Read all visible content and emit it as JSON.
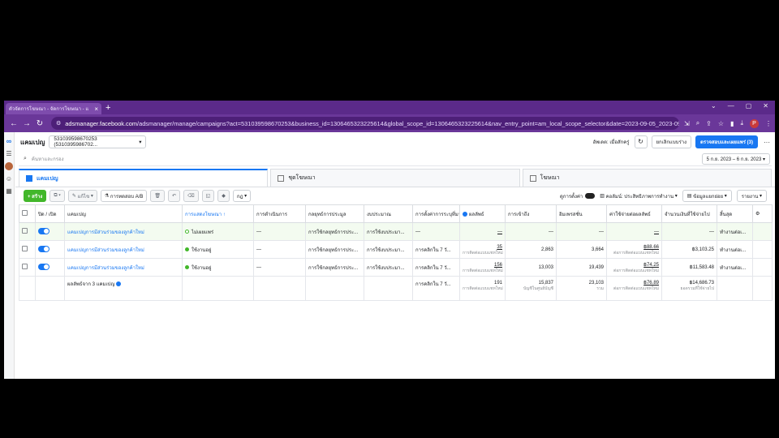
{
  "browser": {
    "tab_title": "ตัวจัดการโฆษณา - จัดการโฆษณา - แ",
    "new_tab": "+",
    "url_domain": "adsmanager.facebook.com",
    "url_path": "/adsmanager/manage/campaigns?act=531039598670253&business_id=1306465323225614&global_scope_id=1306465323225614&nav_entry_point=am_local_scope_selector&date=2023-09-05_2023-09-07&comparison...",
    "profile_letter": "P"
  },
  "header": {
    "title": "แคมเปญ",
    "account": "531039598670253 (5310395986702...",
    "updated": "อัพเดต: เมื่อสักครู่",
    "discard": "ยกเลิกแบบร่าง",
    "review_publish": "ตรวจสอบและเผยแพร่ (3)"
  },
  "search": {
    "placeholder": "ค้นหาและกรอง",
    "date_range": "5 ก.ย. 2023 – 6 ก.ย. 2023"
  },
  "level_tabs": [
    {
      "label": "แคมเปญ"
    },
    {
      "label": "ชุดโฆษณา"
    },
    {
      "label": "โฆษณา"
    }
  ],
  "toolbar": {
    "create": "+ สร้าง",
    "edit": "แก้ไข",
    "ab_test": "การทดสอบ A/B",
    "rules": "กฎ",
    "breakdown_toggle": "ดูการตั้งค่า",
    "columns": "คอลัมน์: ประสิทธิภาพการทำงาน",
    "breakdown": "ข้อมูลแยกย่อย",
    "reports": "รายงาน"
  },
  "table": {
    "headers": [
      "ปิด / เปิด",
      "แคมเปญ",
      "การแสดงโฆษณา ↑",
      "การดำเนินการ",
      "กลยุทธ์การประมูล",
      "งบประมาณ",
      "การตั้งค่าการระบุที่มา",
      "ผลลัพธ์",
      "การเข้าถึง",
      "อิมเพรสชั่น",
      "ค่าใช้จ่ายต่อผลลัพธ์",
      "จำนวนเงินที่ใช้จ่ายไป",
      "สิ้นสุด"
    ],
    "rows": [
      {
        "name": "แคมเปญการมีส่วนร่วมของลูกค้าใหม่",
        "status": "ไม่เผยแพร่",
        "action": "—",
        "bid": "การใช้กลยุทธ์การประ...",
        "budget": "การใช้งบประมา...",
        "attribution": "—",
        "results": "—",
        "results_sub": "",
        "reach": "—",
        "impressions": "—",
        "cpr": "—",
        "cpr_sub": "",
        "spent": "—",
        "end": "ทำงานต่อเ..."
      },
      {
        "name": "แคมเปญการมีส่วนร่วมของลูกค้าใหม่",
        "status": "ใช้งานอยู่",
        "action": "—",
        "bid": "การใช้กลยุทธ์การประ...",
        "budget": "การใช้งบประมา...",
        "attribution": "การคลิกใน 7 วั...",
        "results": "35",
        "results_sub": "การติดต่อแบบแชทใหม่",
        "reach": "2,863",
        "impressions": "3,664",
        "cpr": "฿88.66",
        "cpr_sub": "ต่อการติดต่อแบบแชทใหม่",
        "spent": "฿3,103.25",
        "end": "ทำงานต่อเ..."
      },
      {
        "name": "แคมเปญการมีส่วนร่วมของลูกค้าใหม่",
        "status": "ใช้งานอยู่",
        "action": "—",
        "bid": "การใช้กลยุทธ์การประ...",
        "budget": "การใช้งบประมา...",
        "attribution": "การคลิกใน 7 วั...",
        "results": "156",
        "results_sub": "การติดต่อแบบแชทใหม่",
        "reach": "13,003",
        "impressions": "19,439",
        "cpr": "฿74.25",
        "cpr_sub": "ต่อการติดต่อแบบแชทใหม่",
        "spent": "฿11,583.48",
        "end": "ทำงานต่อเ..."
      }
    ],
    "total": {
      "label": "ผลลัพธ์จาก 3 แคมเปญ",
      "attribution": "การคลิกใน 7 วั...",
      "results": "191",
      "results_sub": "การติดต่อแบบแชทใหม่",
      "reach": "15,837",
      "reach_sub": "บัญชีในศูนย์บัญชี",
      "impressions": "23,103",
      "impressions_sub": "รวม",
      "cpr": "฿76.89",
      "cpr_sub": "ต่อการติดต่อแบบแชทใหม่",
      "spent": "฿14,686.73",
      "spent_sub": "ยอดรวมที่ใช้จ่ายไป"
    }
  },
  "colors": {
    "accent": "#1877f2",
    "chrome": "#6a3799",
    "active": "#42b72a"
  }
}
